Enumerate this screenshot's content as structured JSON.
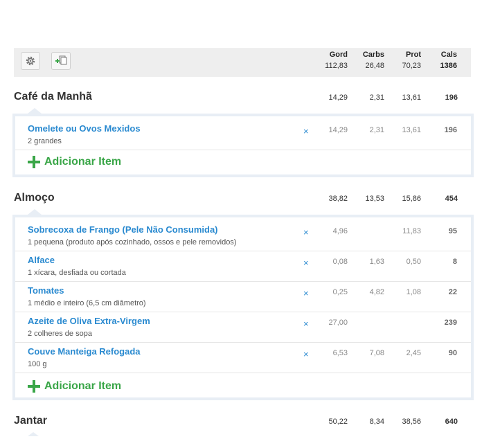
{
  "header": {
    "columns": [
      "Gord",
      "Carbs",
      "Prot",
      "Cals"
    ],
    "totals": [
      "112,83",
      "26,48",
      "70,23",
      "1386"
    ],
    "settings_icon": "gear-icon",
    "copy_icon": "add-copy-icon"
  },
  "add_item_label": "Adicionar Item",
  "meals": [
    {
      "title": "Café da Manhã",
      "totals": [
        "14,29",
        "2,31",
        "13,61",
        "196"
      ],
      "items": [
        {
          "name": "Omelete ou Ovos Mexidos",
          "desc": "2 grandes",
          "gord": "14,29",
          "carbs": "2,31",
          "prot": "13,61",
          "cals": "196"
        }
      ]
    },
    {
      "title": "Almoço",
      "totals": [
        "38,82",
        "13,53",
        "15,86",
        "454"
      ],
      "items": [
        {
          "name": "Sobrecoxa de Frango (Pele Não Consumida)",
          "desc": "1 pequena (produto após cozinhado, ossos e pele removidos)",
          "gord": "4,96",
          "carbs": "",
          "prot": "11,83",
          "cals": "95"
        },
        {
          "name": "Alface",
          "desc": "1 xícara, desfiada ou cortada",
          "gord": "0,08",
          "carbs": "1,63",
          "prot": "0,50",
          "cals": "8"
        },
        {
          "name": "Tomates",
          "desc": "1 médio e inteiro (6,5 cm diâmetro)",
          "gord": "0,25",
          "carbs": "4,82",
          "prot": "1,08",
          "cals": "22"
        },
        {
          "name": "Azeite de Oliva Extra-Virgem",
          "desc": "2 colheres de sopa",
          "gord": "27,00",
          "carbs": "",
          "prot": "",
          "cals": "239"
        },
        {
          "name": "Couve Manteiga Refogada",
          "desc": "100 g",
          "gord": "6,53",
          "carbs": "7,08",
          "prot": "2,45",
          "cals": "90"
        }
      ]
    },
    {
      "title": "Jantar",
      "totals": [
        "50,22",
        "8,34",
        "38,56",
        "640"
      ],
      "items": []
    }
  ]
}
